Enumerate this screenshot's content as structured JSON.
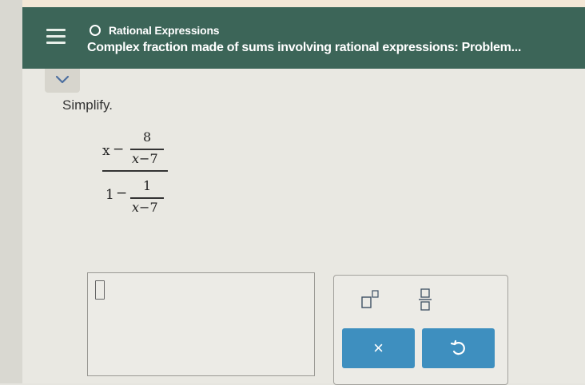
{
  "header": {
    "topic": "Rational Expressions",
    "problem_title": "Complex fraction made of sums involving rational expressions: Problem..."
  },
  "content": {
    "instruction": "Simplify.",
    "expression": {
      "numerator": {
        "lead": "x",
        "op": "−",
        "frac_num": "8",
        "frac_den_var": "x",
        "frac_den_rest": "−7"
      },
      "denominator": {
        "lead": "1",
        "op": "−",
        "frac_num": "1",
        "frac_den_var": "x",
        "frac_den_rest": "−7"
      }
    }
  },
  "answer": {
    "value": ""
  },
  "keypad": {
    "exponent_tool": "superscript-template",
    "fraction_tool": "fraction-template",
    "clear_symbol": "×",
    "undo_symbol": "undo"
  },
  "colors": {
    "header_bg": "#3c6558",
    "button_blue": "#3e8fbf",
    "page_bg": "#e9e8e2"
  }
}
